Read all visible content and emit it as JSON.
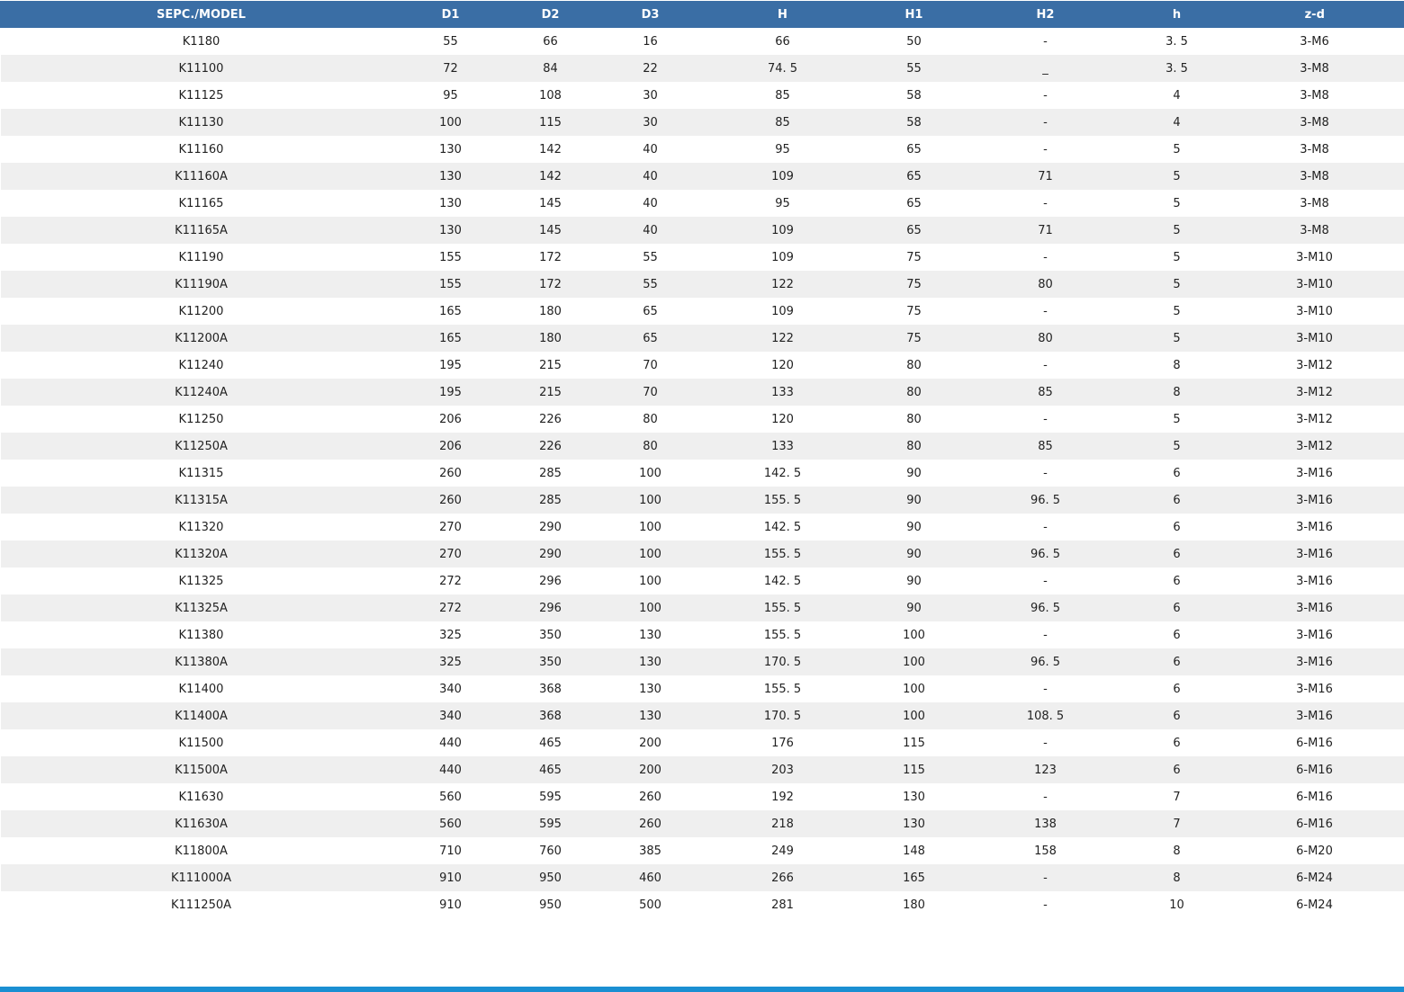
{
  "columns": [
    "SEPC./MODEL",
    "D1",
    "D2",
    "D3",
    "H",
    "H1",
    "H2",
    "h",
    "z-d"
  ],
  "rows": [
    [
      "K1180",
      "55",
      "66",
      "16",
      "66",
      "50",
      "-",
      "3. 5",
      "3-M6"
    ],
    [
      "K11100",
      "72",
      "84",
      "22",
      "74. 5",
      "55",
      "_",
      "3. 5",
      "3-M8"
    ],
    [
      "K11125",
      "95",
      "108",
      "30",
      "85",
      "58",
      "-",
      "4",
      "3-M8"
    ],
    [
      "K11130",
      "100",
      "115",
      "30",
      "85",
      "58",
      "-",
      "4",
      "3-M8"
    ],
    [
      "K11160",
      "130",
      "142",
      "40",
      "95",
      "65",
      "-",
      "5",
      "3-M8"
    ],
    [
      "K11160A",
      "130",
      "142",
      "40",
      "109",
      "65",
      "71",
      "5",
      "3-M8"
    ],
    [
      "K11165",
      "130",
      "145",
      "40",
      "95",
      "65",
      "-",
      "5",
      "3-M8"
    ],
    [
      "K11165A",
      "130",
      "145",
      "40",
      "109",
      "65",
      "71",
      "5",
      "3-M8"
    ],
    [
      "K11190",
      "155",
      "172",
      "55",
      "109",
      "75",
      "-",
      "5",
      "3-M10"
    ],
    [
      "K11190A",
      "155",
      "172",
      "55",
      "122",
      "75",
      "80",
      "5",
      "3-M10"
    ],
    [
      "K11200",
      "165",
      "180",
      "65",
      "109",
      "75",
      "-",
      "5",
      "3-M10"
    ],
    [
      "K11200A",
      "165",
      "180",
      "65",
      "122",
      "75",
      "80",
      "5",
      "3-M10"
    ],
    [
      "K11240",
      "195",
      "215",
      "70",
      "120",
      "80",
      "-",
      "8",
      "3-M12"
    ],
    [
      "K11240A",
      "195",
      "215",
      "70",
      "133",
      "80",
      "85",
      "8",
      "3-M12"
    ],
    [
      "K11250",
      "206",
      "226",
      "80",
      "120",
      "80",
      "-",
      "5",
      "3-M12"
    ],
    [
      "K11250A",
      "206",
      "226",
      "80",
      "133",
      "80",
      "85",
      "5",
      "3-M12"
    ],
    [
      "K11315",
      "260",
      "285",
      "100",
      "142. 5",
      "90",
      "-",
      "6",
      "3-M16"
    ],
    [
      "K11315A",
      "260",
      "285",
      "100",
      "155. 5",
      "90",
      "96. 5",
      "6",
      "3-M16"
    ],
    [
      "K11320",
      "270",
      "290",
      "100",
      "142. 5",
      "90",
      "-",
      "6",
      "3-M16"
    ],
    [
      "K11320A",
      "270",
      "290",
      "100",
      "155. 5",
      "90",
      "96. 5",
      "6",
      "3-M16"
    ],
    [
      "K11325",
      "272",
      "296",
      "100",
      "142. 5",
      "90",
      "-",
      "6",
      "3-M16"
    ],
    [
      "K11325A",
      "272",
      "296",
      "100",
      "155. 5",
      "90",
      "96. 5",
      "6",
      "3-M16"
    ],
    [
      "K11380",
      "325",
      "350",
      "130",
      "155. 5",
      "100",
      "-",
      "6",
      "3-M16"
    ],
    [
      "K11380A",
      "325",
      "350",
      "130",
      "170. 5",
      "100",
      "96. 5",
      "6",
      "3-M16"
    ],
    [
      "K11400",
      "340",
      "368",
      "130",
      "155. 5",
      "100",
      "-",
      "6",
      "3-M16"
    ],
    [
      "K11400A",
      "340",
      "368",
      "130",
      "170. 5",
      "100",
      "108. 5",
      "6",
      "3-M16"
    ],
    [
      "K11500",
      "440",
      "465",
      "200",
      "176",
      "115",
      "-",
      "6",
      "6-M16"
    ],
    [
      "K11500A",
      "440",
      "465",
      "200",
      "203",
      "115",
      "123",
      "6",
      "6-M16"
    ],
    [
      "K11630",
      "560",
      "595",
      "260",
      "192",
      "130",
      "-",
      "7",
      "6-M16"
    ],
    [
      "K11630A",
      "560",
      "595",
      "260",
      "218",
      "130",
      "138",
      "7",
      "6-M16"
    ],
    [
      "K11800A",
      "710",
      "760",
      "385",
      "249",
      "148",
      "158",
      "8",
      "6-M20"
    ],
    [
      "K111000A",
      "910",
      "950",
      "460",
      "266",
      "165",
      "-",
      "8",
      "6-M24"
    ],
    [
      "K111250A",
      "910",
      "950",
      "500",
      "281",
      "180",
      "-",
      "10",
      "6-M24"
    ]
  ]
}
